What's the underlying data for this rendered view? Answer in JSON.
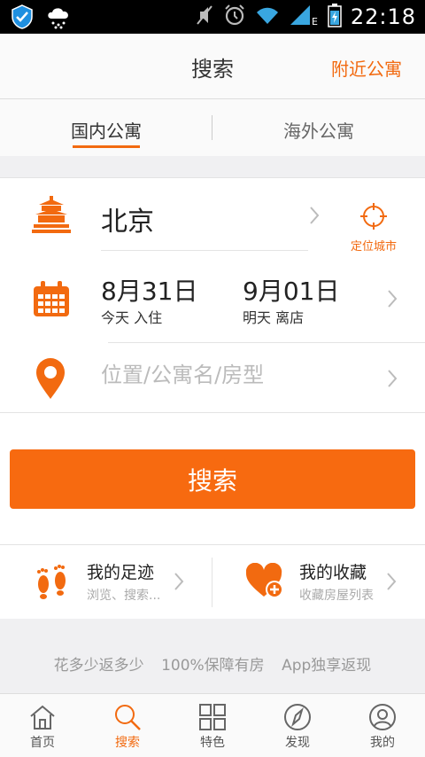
{
  "status_bar": {
    "time": "22:18",
    "network": "E"
  },
  "header": {
    "title": "搜索",
    "nearby": "附近公寓"
  },
  "tabs": [
    {
      "label": "国内公寓",
      "active": true
    },
    {
      "label": "海外公寓",
      "active": false
    }
  ],
  "form": {
    "city": "北京",
    "locate_label": "定位城市",
    "checkin_date": "8月31日",
    "checkin_label": "今天  入住",
    "checkout_date": "9月01日",
    "checkout_label": "明天  离店",
    "location_placeholder": "位置/公寓名/房型",
    "location_value": ""
  },
  "search_button": "搜索",
  "quick_links": [
    {
      "title": "我的足迹",
      "sub": "浏览、搜索..."
    },
    {
      "title": "我的收藏",
      "sub": "收藏房屋列表"
    }
  ],
  "promo": [
    "花多少返多少",
    "100%保障有房",
    "App独享返现"
  ],
  "tabbar": [
    {
      "label": "首页",
      "icon": "home-icon",
      "active": false
    },
    {
      "label": "搜索",
      "icon": "search-icon",
      "active": true
    },
    {
      "label": "特色",
      "icon": "grid-icon",
      "active": false
    },
    {
      "label": "发现",
      "icon": "compass-icon",
      "active": false
    },
    {
      "label": "我的",
      "icon": "user-icon",
      "active": false
    }
  ],
  "colors": {
    "accent": "#f26a10",
    "button": "#f76a10",
    "background": "#f0f0f2"
  }
}
